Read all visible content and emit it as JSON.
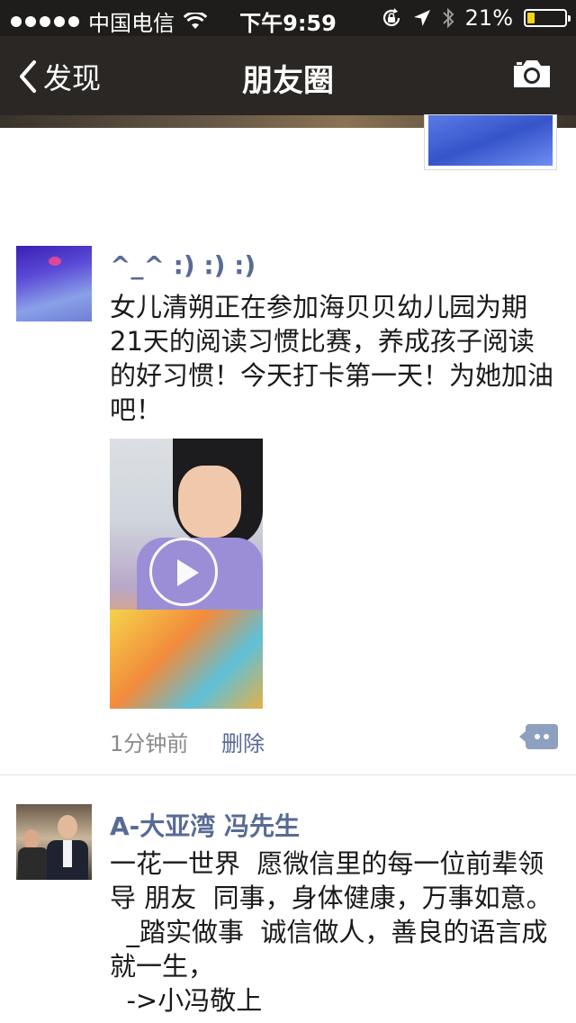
{
  "status_bar": {
    "carrier": "中国电信",
    "time": "下午9:59",
    "battery_percent": "21%",
    "battery_level": 0.21,
    "icons": [
      "signal-dots-icon",
      "wifi-icon",
      "rotation-lock-icon",
      "location-arrow-icon",
      "bluetooth-icon",
      "battery-icon"
    ]
  },
  "nav": {
    "back_label": "发现",
    "title": "朋友圈",
    "back_icon": "chevron-left-icon",
    "camera_icon": "camera-icon"
  },
  "feed": {
    "posts": [
      {
        "nickname": "^_^ :) :) :)",
        "text": "女儿清朔正在参加海贝贝幼儿园为期21天的阅读习惯比赛，养成孩子阅读的好习惯！今天打卡第一天！为她加油吧！",
        "time": "1分钟前",
        "delete_label": "删除",
        "media": "video"
      },
      {
        "nickname": "A-大亚湾  冯先生",
        "text": "一花一世界  愿微信里的每一位前辈领导 朋友  同事，身体健康，万事如意。\n  _踏实做事  诚信做人，善良的语言成就一生，\n  ->小冯敬上"
      }
    ]
  }
}
